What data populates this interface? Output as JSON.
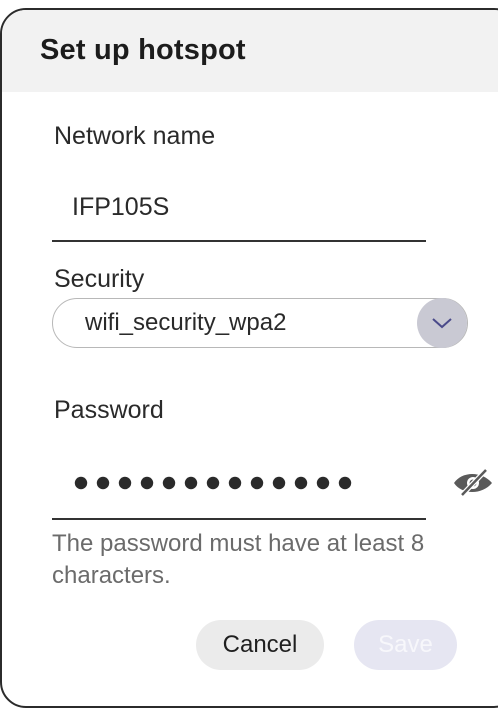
{
  "dialog": {
    "title": "Set up hotspot"
  },
  "network_name": {
    "label": "Network name",
    "value": "IFP105S"
  },
  "security": {
    "label": "Security",
    "selected": "wifi_security_wpa2",
    "icon": "chevron-down-icon"
  },
  "password": {
    "label": "Password",
    "masked": true,
    "visibility_icon": "eye-off-icon",
    "helper": "The password must have at least 8 characters."
  },
  "buttons": {
    "cancel": "Cancel",
    "save": "Save"
  },
  "colors": {
    "header_bg": "#f2f2f2",
    "accent_arrow_bg": "#c9c9d3",
    "disabled_button_bg": "#e6e6f2",
    "helper_text": "#6b6b6b"
  }
}
